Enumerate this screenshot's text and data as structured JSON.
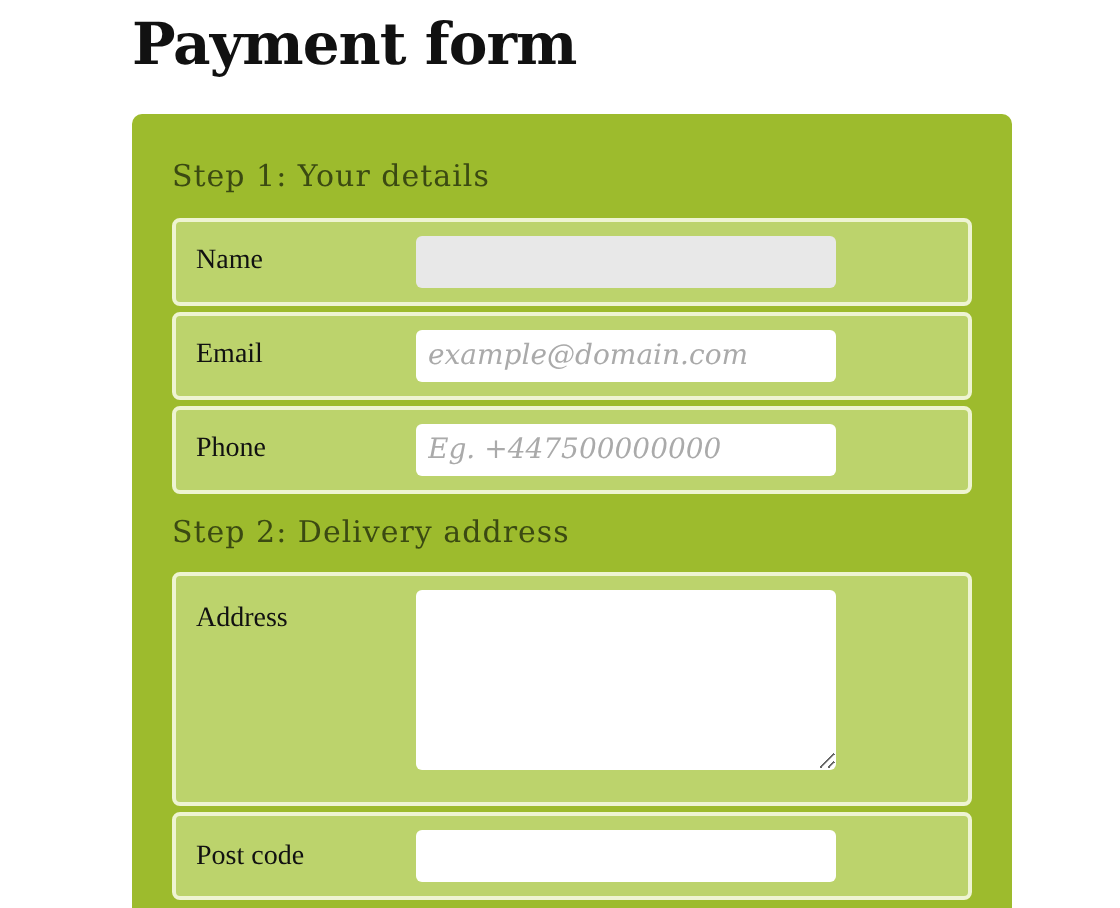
{
  "title": "Payment form",
  "sections": [
    {
      "heading": "Step 1: Your details",
      "fields": [
        {
          "label": "Name",
          "kind": "input",
          "focused": true
        },
        {
          "label": "Email",
          "kind": "input",
          "placeholder": "example@domain.com",
          "focused": false
        },
        {
          "label": "Phone",
          "kind": "input",
          "placeholder": "Eg. +447500000000",
          "focused": false
        }
      ]
    },
    {
      "heading": "Step 2: Delivery address",
      "fields": [
        {
          "label": "Address",
          "kind": "textarea",
          "focused": false
        },
        {
          "label": "Post code",
          "kind": "input",
          "focused": false
        }
      ]
    }
  ]
}
